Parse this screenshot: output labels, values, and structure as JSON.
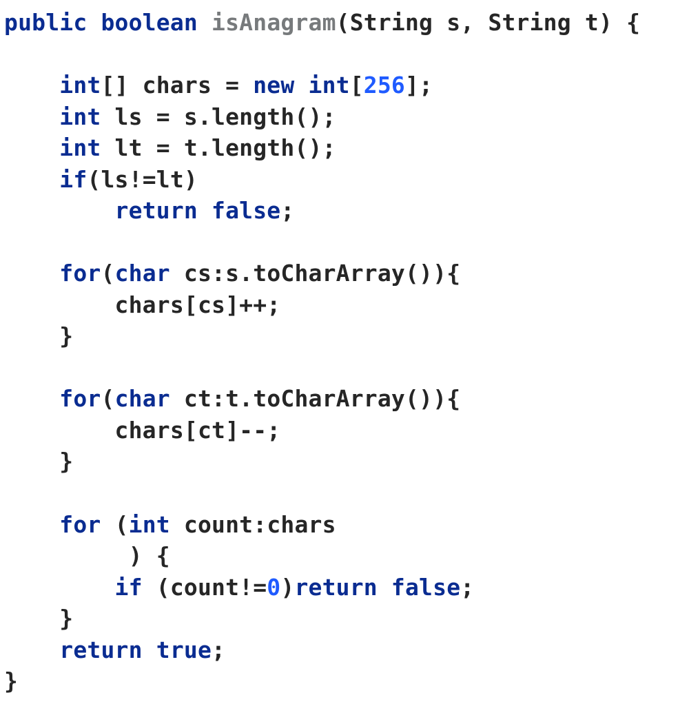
{
  "code": {
    "lines": [
      {
        "indent": 0,
        "tokens": [
          {
            "t": "public",
            "c": "kw"
          },
          {
            "t": " ",
            "c": "p"
          },
          {
            "t": "boolean",
            "c": "kw"
          },
          {
            "t": " ",
            "c": "p"
          },
          {
            "t": "isAnagram",
            "c": "fn"
          },
          {
            "t": "(String s, String t) {",
            "c": "txt"
          }
        ]
      },
      {
        "indent": 0,
        "tokens": []
      },
      {
        "indent": 1,
        "tokens": [
          {
            "t": "int",
            "c": "kw"
          },
          {
            "t": "[] chars = ",
            "c": "txt"
          },
          {
            "t": "new int",
            "c": "kw"
          },
          {
            "t": "[",
            "c": "txt"
          },
          {
            "t": "256",
            "c": "num"
          },
          {
            "t": "];",
            "c": "txt"
          }
        ]
      },
      {
        "indent": 1,
        "tokens": [
          {
            "t": "int",
            "c": "kw"
          },
          {
            "t": " ls = s.length();",
            "c": "txt"
          }
        ]
      },
      {
        "indent": 1,
        "tokens": [
          {
            "t": "int",
            "c": "kw"
          },
          {
            "t": " lt = t.length();",
            "c": "txt"
          }
        ]
      },
      {
        "indent": 1,
        "tokens": [
          {
            "t": "if",
            "c": "kw"
          },
          {
            "t": "(ls!=lt)",
            "c": "txt"
          }
        ]
      },
      {
        "indent": 2,
        "tokens": [
          {
            "t": "return false",
            "c": "kw"
          },
          {
            "t": ";",
            "c": "txt"
          }
        ]
      },
      {
        "indent": 0,
        "tokens": []
      },
      {
        "indent": 1,
        "tokens": [
          {
            "t": "for",
            "c": "kw"
          },
          {
            "t": "(",
            "c": "txt"
          },
          {
            "t": "char",
            "c": "kw"
          },
          {
            "t": " cs:s.toCharArray()){",
            "c": "txt"
          }
        ]
      },
      {
        "indent": 2,
        "tokens": [
          {
            "t": "chars[cs]++;",
            "c": "txt"
          }
        ]
      },
      {
        "indent": 1,
        "tokens": [
          {
            "t": "}",
            "c": "txt"
          }
        ]
      },
      {
        "indent": 0,
        "tokens": []
      },
      {
        "indent": 1,
        "tokens": [
          {
            "t": "for",
            "c": "kw"
          },
          {
            "t": "(",
            "c": "txt"
          },
          {
            "t": "char",
            "c": "kw"
          },
          {
            "t": " ct:t.toCharArray()){",
            "c": "txt"
          }
        ]
      },
      {
        "indent": 2,
        "tokens": [
          {
            "t": "chars[ct]--;",
            "c": "txt"
          }
        ]
      },
      {
        "indent": 1,
        "tokens": [
          {
            "t": "}",
            "c": "txt"
          }
        ]
      },
      {
        "indent": 0,
        "tokens": []
      },
      {
        "indent": 1,
        "tokens": [
          {
            "t": "for ",
            "c": "kw"
          },
          {
            "t": "(",
            "c": "txt"
          },
          {
            "t": "int",
            "c": "kw"
          },
          {
            "t": " count:chars",
            "c": "txt"
          }
        ]
      },
      {
        "indent": 2,
        "tokens": [
          {
            "t": " ) {",
            "c": "txt"
          }
        ]
      },
      {
        "indent": 2,
        "tokens": [
          {
            "t": "if ",
            "c": "kw"
          },
          {
            "t": "(count!=",
            "c": "txt"
          },
          {
            "t": "0",
            "c": "num"
          },
          {
            "t": ")",
            "c": "txt"
          },
          {
            "t": "return false",
            "c": "kw"
          },
          {
            "t": ";",
            "c": "txt"
          }
        ]
      },
      {
        "indent": 1,
        "tokens": [
          {
            "t": "}",
            "c": "txt"
          }
        ]
      },
      {
        "indent": 1,
        "tokens": [
          {
            "t": "return true",
            "c": "kw"
          },
          {
            "t": ";",
            "c": "txt"
          }
        ]
      },
      {
        "indent": 0,
        "tokens": [
          {
            "t": "}",
            "c": "txt"
          }
        ]
      }
    ],
    "indent_unit": "    "
  }
}
